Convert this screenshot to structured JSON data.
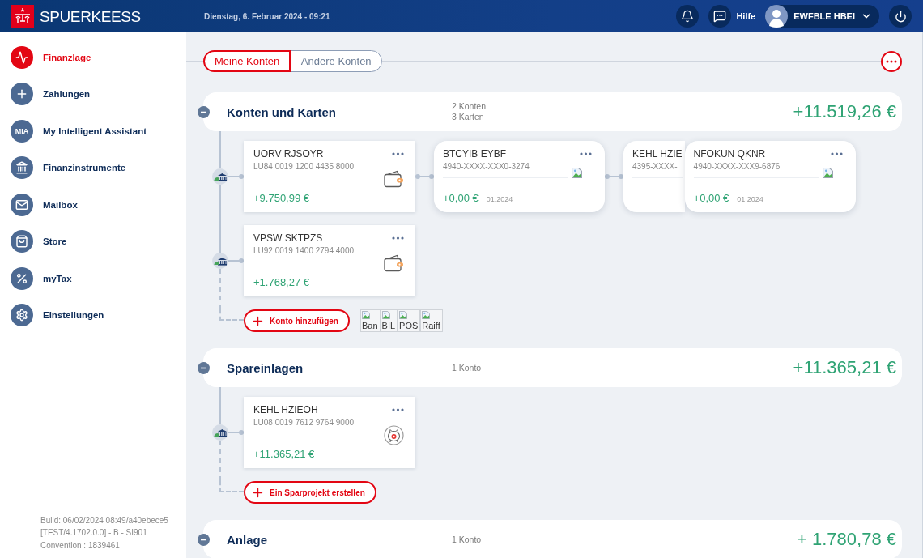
{
  "header": {
    "logo": "SPUERKEESS",
    "date": "Dienstag, 6. Februar 2024 - 09:21",
    "help": "Hilfe",
    "user": "EWFBLE HBEI"
  },
  "sidebar": {
    "items": [
      {
        "label": "Finanzlage",
        "selected": true
      },
      {
        "label": "Zahlungen",
        "selected": false
      },
      {
        "label": "My Intelligent Assistant",
        "selected": false,
        "badge": "MIA"
      },
      {
        "label": "Finanzinstrumente",
        "selected": false
      },
      {
        "label": "Mailbox",
        "selected": false
      },
      {
        "label": "Store",
        "selected": false
      },
      {
        "label": "myTax",
        "selected": false
      },
      {
        "label": "Einstellungen",
        "selected": false
      }
    ],
    "build_info": [
      "Build: 06/02/2024 08:49/a40ebece5",
      "[TEST/4.1702.0.0] - B - SI901",
      "Convention : 1839461"
    ]
  },
  "tabs": [
    {
      "label": "Meine Konten",
      "selected": true
    },
    {
      "label": "Andere Konten",
      "selected": false
    }
  ],
  "sections": [
    {
      "title": "Konten und Karten",
      "counts": [
        "2 Konten",
        "3 Karten"
      ],
      "total": "+11.519,26 €",
      "expanded": true,
      "rows": [
        {
          "account": {
            "kind": "current",
            "name": "UORV RJSOYR",
            "iban": "LU84 0019 1200 4435 8000",
            "balance": "+9.750,99 €"
          },
          "cards": [
            {
              "name": "BTCYIB EYBF",
              "number": "4940-XXXX-XXX0-3274",
              "balance": "+0,00 €",
              "date": "01.2024",
              "covered": false
            },
            {
              "name": "KEHL HZIE",
              "number": "4395-XXXX-",
              "covered": true
            },
            {
              "name": "NFOKUN QKNR",
              "number": "4940-XXXX-XXX9-6876",
              "balance": "+0,00 €",
              "date": "01.2024",
              "covered": false
            }
          ]
        },
        {
          "account": {
            "kind": "current",
            "name": "VPSW SKTPZS",
            "iban": "LU92 0019 1400 2794 4000",
            "balance": "+1.768,27 €"
          }
        }
      ],
      "add_button": "Konto hinzufügen",
      "bank_logos": [
        "Ban",
        "BIL",
        "POS",
        "Raiff"
      ]
    },
    {
      "title": "Spareinlagen",
      "counts": [
        "1 Konto"
      ],
      "total": "+11.365,21 €",
      "expanded": true,
      "rows": [
        {
          "account": {
            "kind": "savings",
            "name": "KEHL HZIEOH",
            "iban": "LU08 0019 7612 9764 9000",
            "balance": "+11.365,21 €"
          }
        }
      ],
      "add_button": "Ein Sparprojekt erstellen"
    },
    {
      "title": "Anlage",
      "counts": [
        "1 Konto"
      ],
      "total": "+ 1.780,78 €",
      "expanded": true
    }
  ]
}
